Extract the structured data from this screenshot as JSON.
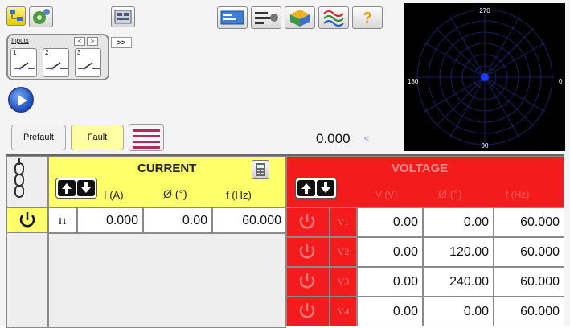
{
  "toolbar": {
    "left_icons": [
      "network-icon",
      "settings-gear-icon",
      "test-setup-icon"
    ],
    "right_icons": [
      "test-screen-icon",
      "sequence-icon",
      "3d-view-icon",
      "waveform-icon"
    ],
    "help_label": "?"
  },
  "inputs_panel": {
    "label": "Inputs",
    "prev_label": "<",
    "next_label": ">",
    "more_label": ">>",
    "slots": [
      "1",
      "2",
      "3"
    ]
  },
  "tabs": {
    "prefault": "Prefault",
    "fault": "Fault"
  },
  "timer": {
    "value": "0.000",
    "unit": "s"
  },
  "polar": {
    "label_top": "270",
    "label_left": "180",
    "label_right": "0",
    "label_bottom": "90"
  },
  "current": {
    "title": "CURRENT",
    "col_i": "I (A)",
    "col_phi": "Ø  (°)",
    "col_f": "f  (Hz)",
    "rows": [
      {
        "channel": "I1",
        "i": "0.000",
        "phi": "0.00",
        "f": "60.000"
      }
    ]
  },
  "voltage": {
    "title": "VOLTAGE",
    "col_v": "V (V)",
    "col_phi": "Ø  (°)",
    "col_f": "f  (Hz)",
    "rows": [
      {
        "channel": "V1",
        "v": "0.00",
        "phi": "0.00",
        "f": "60.000"
      },
      {
        "channel": "V2",
        "v": "0.00",
        "phi": "120.00",
        "f": "60.000"
      },
      {
        "channel": "V3",
        "v": "0.00",
        "phi": "240.00",
        "f": "60.000"
      },
      {
        "channel": "V4",
        "v": "0.00",
        "phi": "0.00",
        "f": "60.000"
      }
    ]
  },
  "colors": {
    "current_header": "#ffff6a",
    "voltage_header": "#f31b1b",
    "accent_blue": "#1b4fbf"
  }
}
